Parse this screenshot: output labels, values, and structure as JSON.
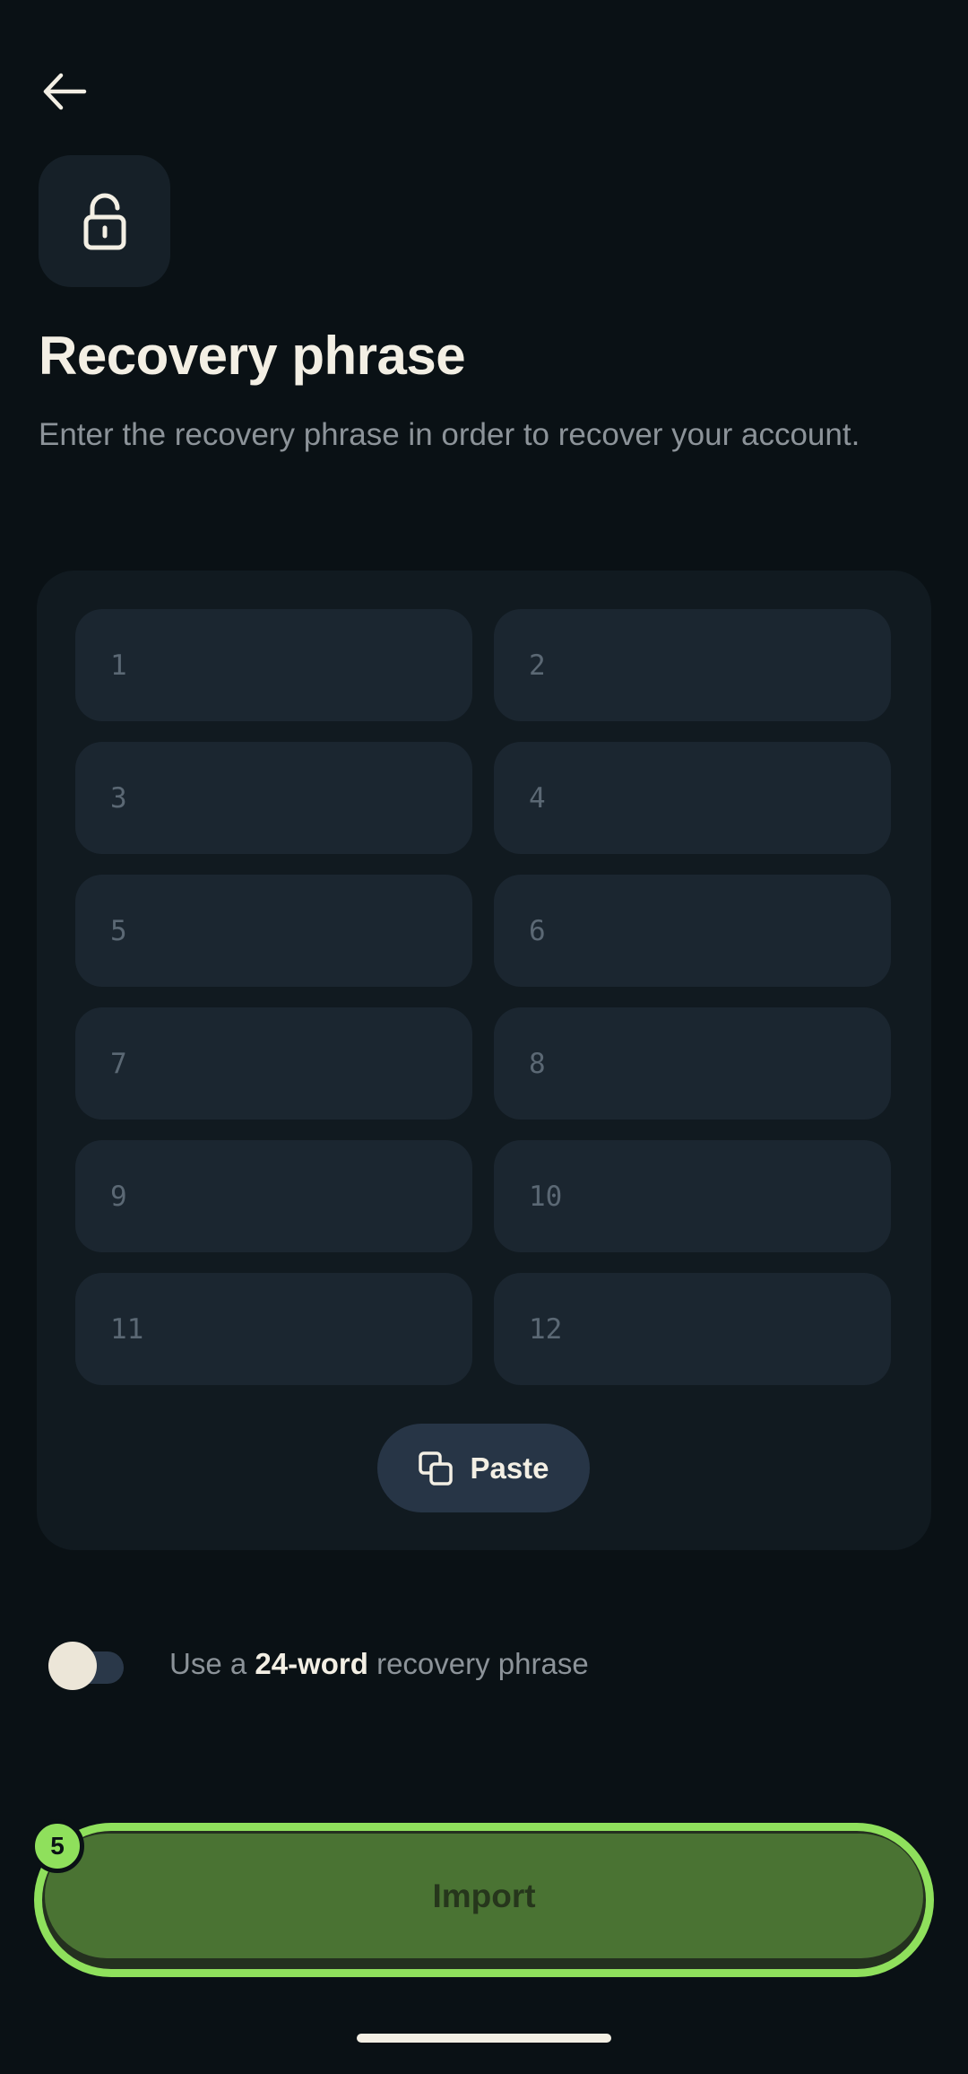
{
  "header": {
    "back_icon": "arrow-left-icon",
    "lock_icon": "unlock-icon"
  },
  "title": "Recovery phrase",
  "subtitle": "Enter the recovery phrase in order to recover your account.",
  "word_fields": [
    {
      "placeholder": "1",
      "value": ""
    },
    {
      "placeholder": "2",
      "value": ""
    },
    {
      "placeholder": "3",
      "value": ""
    },
    {
      "placeholder": "4",
      "value": ""
    },
    {
      "placeholder": "5",
      "value": ""
    },
    {
      "placeholder": "6",
      "value": ""
    },
    {
      "placeholder": "7",
      "value": ""
    },
    {
      "placeholder": "8",
      "value": ""
    },
    {
      "placeholder": "9",
      "value": ""
    },
    {
      "placeholder": "10",
      "value": ""
    },
    {
      "placeholder": "11",
      "value": ""
    },
    {
      "placeholder": "12",
      "value": ""
    }
  ],
  "paste_button": {
    "label": "Paste",
    "icon": "copy-icon"
  },
  "toggle": {
    "text_before": "Use a ",
    "text_bold": "24-word",
    "text_after": " recovery phrase",
    "enabled": false
  },
  "import_button": {
    "label": "Import",
    "badge": "5"
  },
  "colors": {
    "background": "#0a1115",
    "panel": "#111a20",
    "field": "#1b2630",
    "accent_green": "#8fe05c",
    "button_green": "#4a7333",
    "text_primary": "#f3efe4",
    "text_muted": "#8c9399"
  }
}
